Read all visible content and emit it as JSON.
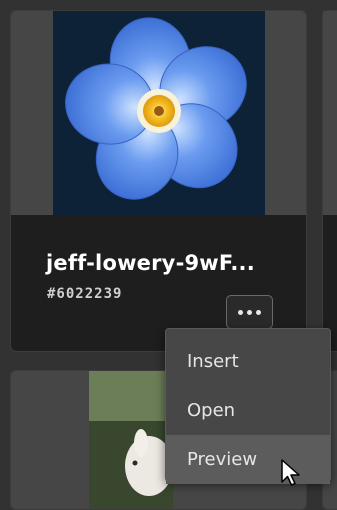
{
  "cards": [
    {
      "title": "jeff-lowery-9wF...",
      "id": "#6022239",
      "thumbnail_icon": "forget-me-not-flower-image",
      "more_label": "more-options"
    },
    {
      "thumbnail_icon": "white-rabbit-in-grass-image"
    }
  ],
  "context_menu": {
    "items": [
      {
        "label": "Insert"
      },
      {
        "label": "Open"
      },
      {
        "label": "Preview",
        "hovered": true
      }
    ]
  },
  "colors": {
    "background": "#323232",
    "card": "#1e1e1e",
    "menu": "#474747",
    "menu_hover": "#5c5c5c",
    "flower_blue": "#5a8fe6",
    "flower_center": "#f1b81e"
  }
}
